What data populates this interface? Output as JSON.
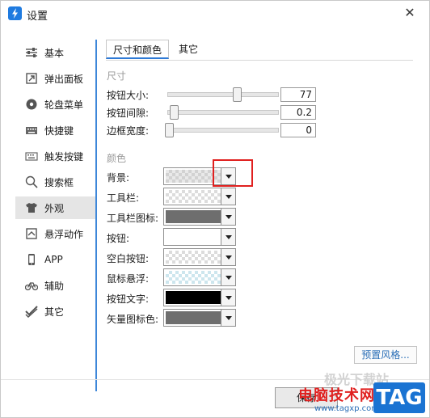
{
  "window": {
    "title": "设置",
    "close_glyph": "✕"
  },
  "sidebar": {
    "items": [
      {
        "label": "基本",
        "icon": "sliders-icon"
      },
      {
        "label": "弹出面板",
        "icon": "popup-panel-icon"
      },
      {
        "label": "轮盘菜单",
        "icon": "wheel-menu-icon"
      },
      {
        "label": "快捷键",
        "icon": "keyboard-icon"
      },
      {
        "label": "触发按键",
        "icon": "trigger-key-icon"
      },
      {
        "label": "搜索框",
        "icon": "search-icon"
      },
      {
        "label": "外观",
        "icon": "shirt-icon"
      },
      {
        "label": "悬浮动作",
        "icon": "hover-action-icon"
      },
      {
        "label": "APP",
        "icon": "phone-icon"
      },
      {
        "label": "辅助",
        "icon": "bicycle-icon"
      },
      {
        "label": "其它",
        "icon": "check-icon"
      }
    ],
    "active_index": 6
  },
  "tabs": [
    {
      "label": "尺寸和颜色"
    },
    {
      "label": "其它"
    }
  ],
  "size_section": {
    "title": "尺寸",
    "rows": [
      {
        "label": "按钮大小:",
        "value": "77",
        "level": 0.47
      },
      {
        "label": "按钮间隙:",
        "value": "0.2",
        "level": 0.03
      },
      {
        "label": "边框宽度:",
        "value": "0",
        "level": 0.0
      }
    ]
  },
  "color_section": {
    "title": "颜色",
    "rows": [
      {
        "label": "背景:",
        "swatch": "checker-gray"
      },
      {
        "label": "工具栏:",
        "swatch": "checker"
      },
      {
        "label": "工具栏图标:",
        "swatch": "#6e6e6e"
      },
      {
        "label": "按钮:",
        "swatch": "#ffffff"
      },
      {
        "label": "空白按钮:",
        "swatch": "checker"
      },
      {
        "label": "鼠标悬浮:",
        "swatch": "checker-blue"
      },
      {
        "label": "按钮文字:",
        "swatch": "#000000"
      },
      {
        "label": "矢量图标色:",
        "swatch": "#6e6e6e"
      }
    ]
  },
  "footer": {
    "preset_label": "预置风格...",
    "save_label": "保存"
  },
  "watermark": {
    "site_text": "电脑技术网",
    "url": "www.tagxp.com",
    "tag": "TAG",
    "faint": "极光下载站"
  },
  "colors": {
    "accent": "#3e87d9",
    "highlight": "#e0201f"
  }
}
